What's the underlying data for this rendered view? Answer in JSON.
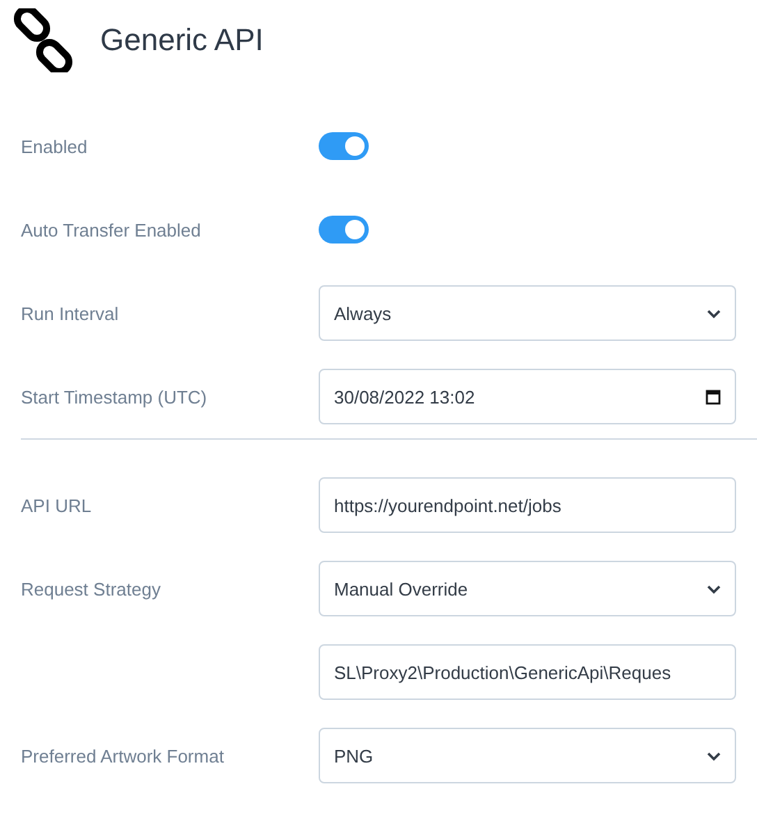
{
  "title": "Generic API",
  "sections": [
    [
      {
        "kind": "toggle",
        "label": "Enabled",
        "on": true
      },
      {
        "kind": "toggle",
        "label": "Auto Transfer Enabled",
        "on": true
      },
      {
        "kind": "select",
        "label": "Run Interval",
        "value": "Always"
      },
      {
        "kind": "datetime",
        "label": "Start Timestamp (UTC)",
        "value": "30/08/2022 13:02"
      }
    ],
    [
      {
        "kind": "text",
        "label": "API URL",
        "value": "https://yourendpoint.net/jobs"
      },
      {
        "kind": "select",
        "label": "Request Strategy",
        "value": "Manual Override"
      },
      {
        "kind": "text",
        "value": "SL\\Proxy2\\Production\\GenericApi\\Reques"
      },
      {
        "kind": "select",
        "label": "Preferred Artwork Format",
        "value": "PNG"
      }
    ]
  ]
}
